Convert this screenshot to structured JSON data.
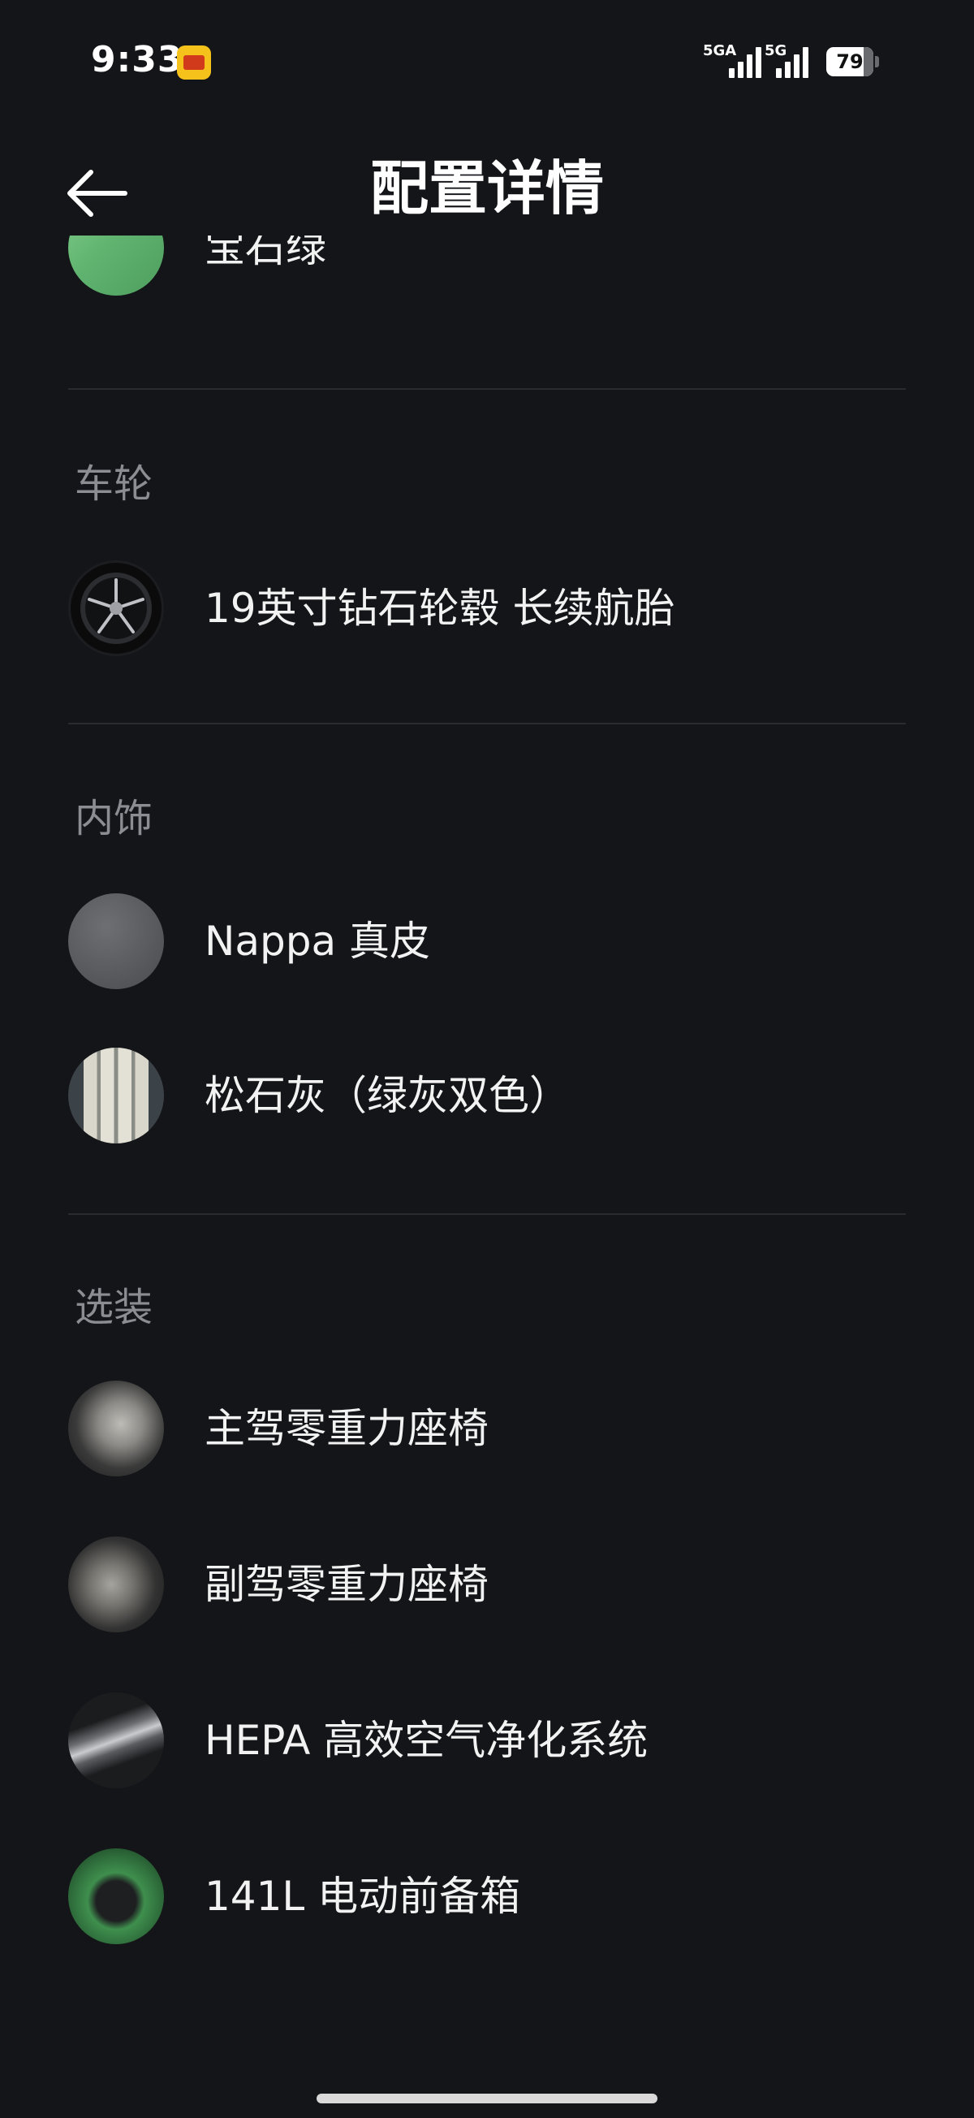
{
  "status_bar": {
    "time": "9:33",
    "signal1_label": "5GA",
    "signal2_label": "5G",
    "battery_percent": "79",
    "battery_level": 0.79
  },
  "header": {
    "title": "配置详情",
    "back_icon": "arrow-left-icon"
  },
  "exterior_color": {
    "label": "宝石绿",
    "swatch_color": "#5fb36f"
  },
  "sections": {
    "wheels": {
      "title": "车轮",
      "items": [
        {
          "label": "19英寸钻石轮毂 长续航胎",
          "icon": "wheel-icon"
        }
      ]
    },
    "interior": {
      "title": "内饰",
      "items": [
        {
          "label": "Nappa 真皮",
          "icon": "leather-texture-icon"
        },
        {
          "label": "松石灰（绿灰双色）",
          "icon": "seat-color-icon"
        }
      ]
    },
    "options": {
      "title": "选装",
      "items": [
        {
          "label": "主驾零重力座椅",
          "icon": "driver-seat-icon"
        },
        {
          "label": "副驾零重力座椅",
          "icon": "passenger-seat-icon"
        },
        {
          "label": "HEPA 高效空气净化系统",
          "icon": "air-filter-icon"
        },
        {
          "label": "141L 电动前备箱",
          "icon": "front-trunk-icon"
        }
      ]
    }
  },
  "colors": {
    "background": "#141518",
    "divider": "#2a2b2f",
    "section_title": "#8c8d92",
    "text": "#f2f2f2"
  }
}
